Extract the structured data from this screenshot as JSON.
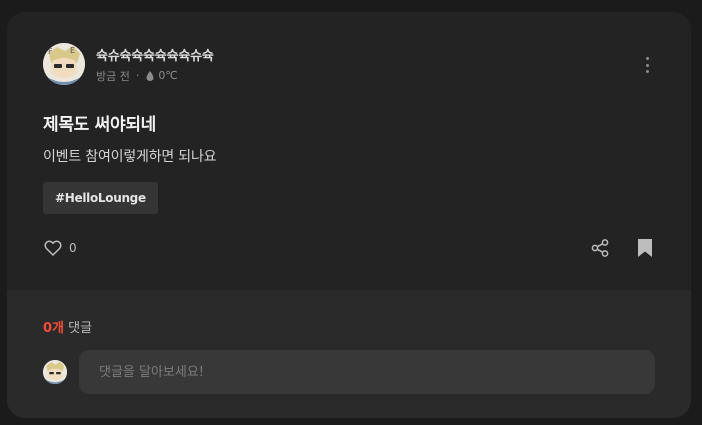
{
  "author": {
    "name": "슉슈슉슉슉슉슉슉슈슉",
    "time": "방금 전",
    "separator": "·",
    "temperature": "0℃",
    "avatar_icon": "anime-character-avatar"
  },
  "post": {
    "title": "제목도 써야되네",
    "body": "이벤트 참여이렇게하면 되나요",
    "tag": "#HelloLounge",
    "like_count": "0",
    "icons": {
      "more": "more-vertical-icon",
      "like": "heart-outline-icon",
      "share": "share-icon",
      "bookmark": "bookmark-icon",
      "temperature": "drop-icon"
    }
  },
  "comments": {
    "count": "0개",
    "label": "댓글",
    "input_placeholder": "댓글을 달아보세요!",
    "input_value": ""
  },
  "colors": {
    "page_bg": "#1b1b1b",
    "card_bg": "#232323",
    "comments_bg": "#2a2a2a",
    "accent": "#f24e3a",
    "tag_bg": "#353535",
    "input_bg": "#383838"
  }
}
